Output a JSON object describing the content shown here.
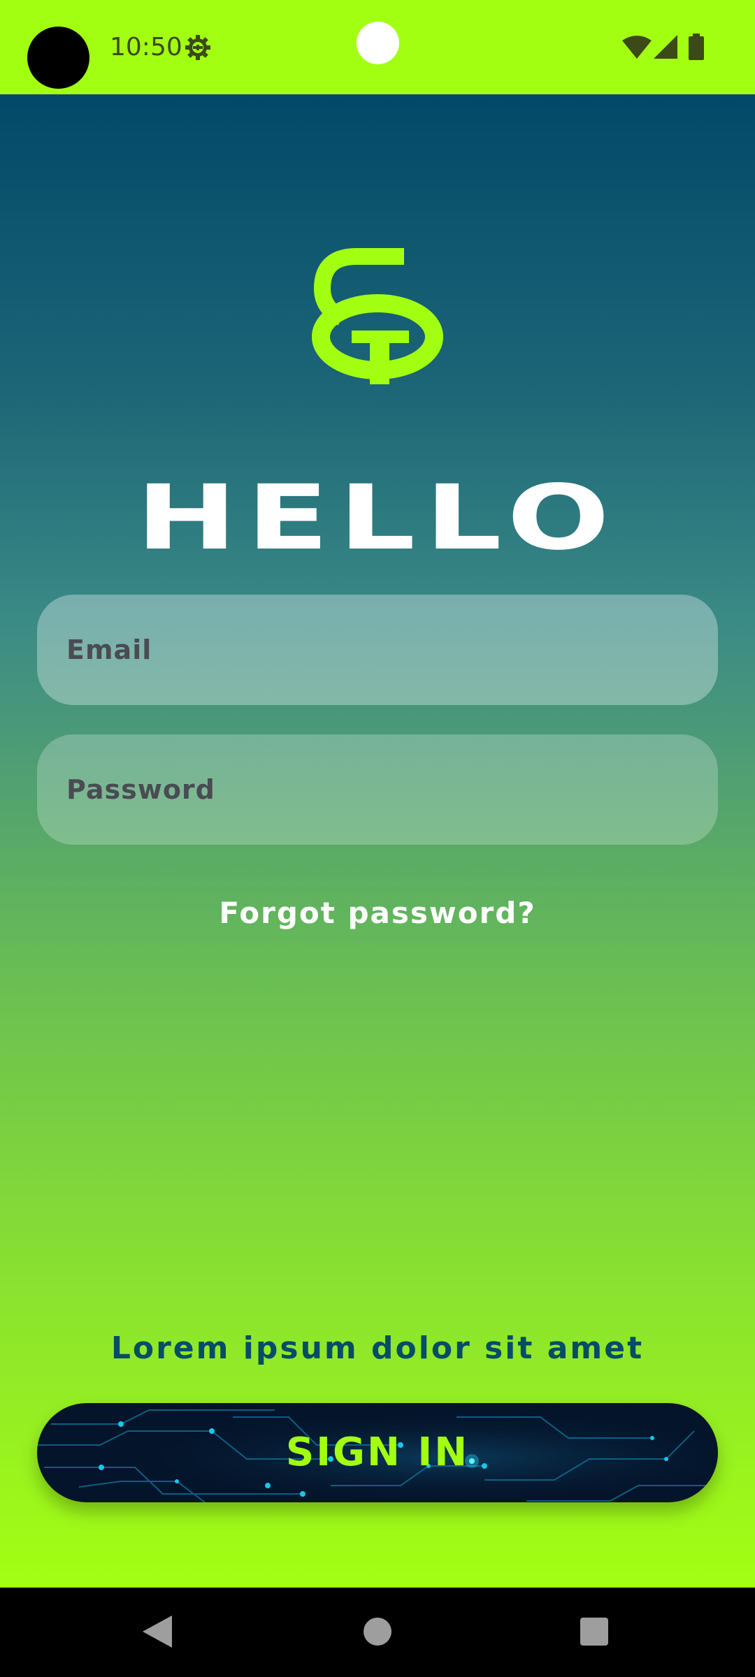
{
  "status_bar": {
    "time": "10:50",
    "icons": [
      "gear-icon",
      "wifi-icon",
      "signal-icon",
      "battery-icon"
    ]
  },
  "login": {
    "title": "HELLO",
    "email_placeholder": "Email",
    "password_placeholder": "Password",
    "forgot_label": "Forgot password?",
    "tagline": "Lorem ipsum dolor sit amet",
    "signin_label": "SIGN IN"
  },
  "nav_bar": {
    "icons": [
      "back-icon",
      "home-icon",
      "recents-icon"
    ]
  },
  "colors": {
    "accent": "#a3ff12",
    "gradient_top": "#024869",
    "tagline": "#064d66",
    "button_bg": "#04142a"
  }
}
